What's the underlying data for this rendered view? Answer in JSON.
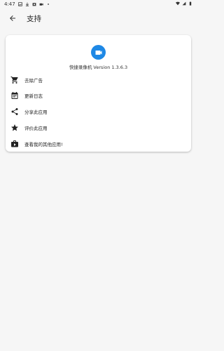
{
  "status_bar": {
    "time": "4:47",
    "icons": [
      "image-icon",
      "download-icon",
      "camera-icon",
      "video-icon",
      "dot-icon"
    ],
    "right_icons": [
      "wifi-icon",
      "signal-icon",
      "battery-icon"
    ]
  },
  "app_bar": {
    "back_icon": "back-arrow-icon",
    "title": "支持"
  },
  "card": {
    "app_icon": "video-camera-icon",
    "app_icon_color": "#1e88e5",
    "version_text": "快捷录像机 Version 1.3.6.3",
    "items": [
      {
        "icon": "cart-icon",
        "label": "去除广告"
      },
      {
        "icon": "calendar-icon",
        "label": "更新日志"
      },
      {
        "icon": "share-icon",
        "label": "分享此应用"
      },
      {
        "icon": "star-icon",
        "label": "评价此应用"
      },
      {
        "icon": "store-bag-icon",
        "label": "查看我的其他应用!"
      }
    ]
  }
}
